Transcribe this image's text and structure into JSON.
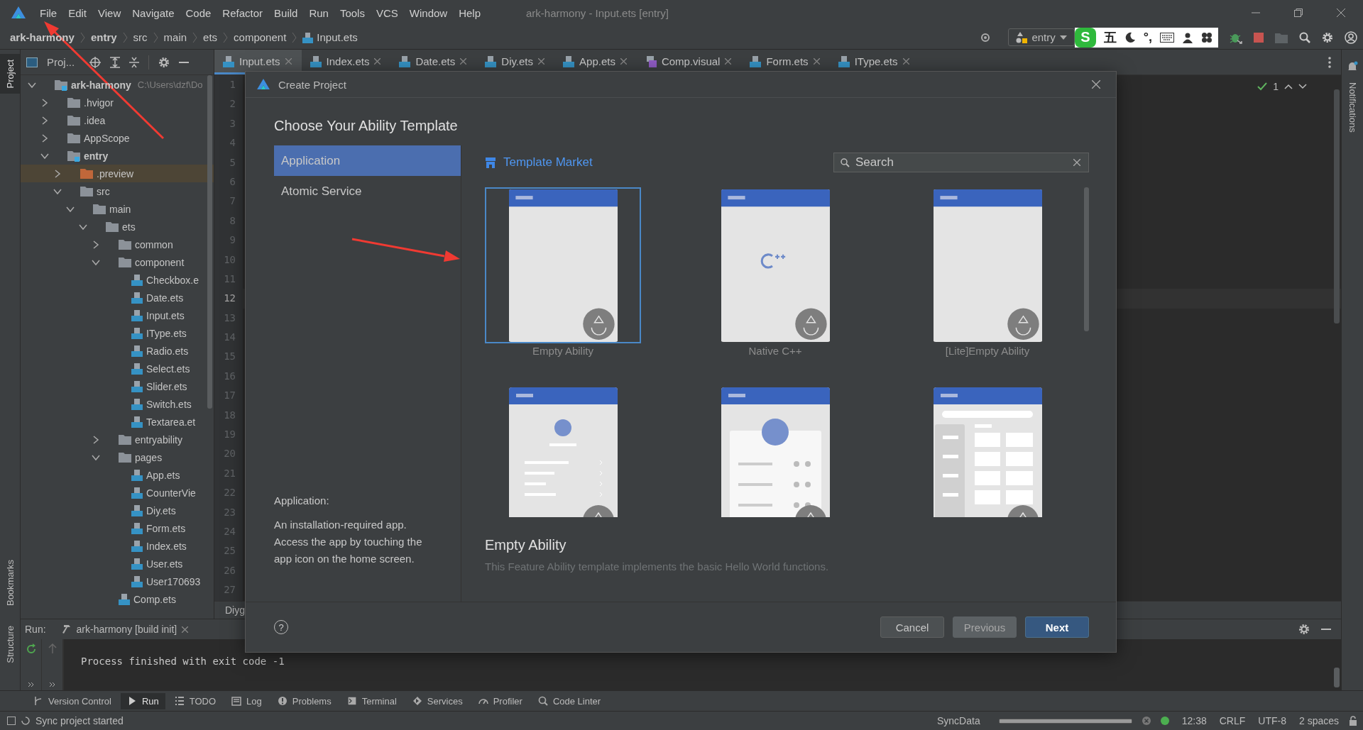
{
  "menu_bar": {
    "items": [
      "File",
      "Edit",
      "View",
      "Navigate",
      "Code",
      "Refactor",
      "Build",
      "Run",
      "Tools",
      "VCS",
      "Window",
      "Help"
    ],
    "window_title": "ark-harmony - Input.ets [entry]"
  },
  "nav_bar": {
    "crumbs": [
      {
        "label": "ark-harmony",
        "kind": "module"
      },
      {
        "label": "entry",
        "kind": "module"
      },
      {
        "label": "src",
        "kind": "folder"
      },
      {
        "label": "main",
        "kind": "folder"
      },
      {
        "label": "ets",
        "kind": "folder"
      },
      {
        "label": "component",
        "kind": "folder"
      },
      {
        "label": "Input.ets",
        "kind": "file"
      }
    ],
    "configuration": "entry",
    "ime": {
      "logo": "S",
      "mode": "五",
      "punctuation": "°,"
    }
  },
  "left_tool_windows": [
    {
      "label": "Project",
      "selected": true
    },
    {
      "label": "Bookmarks",
      "selected": false
    },
    {
      "label": "Structure",
      "selected": false
    }
  ],
  "right_tool_windows": [
    {
      "label": "Notifications",
      "selected": false
    }
  ],
  "project_panel": {
    "title": "Proj...",
    "tree": [
      {
        "label": "ark-harmony",
        "kind": "module",
        "path": "C:\\Users\\dzf\\Do",
        "expanded": true,
        "selected": false,
        "children": [
          {
            "label": ".hvigor",
            "kind": "folder",
            "expanded": false,
            "selected": false
          },
          {
            "label": ".idea",
            "kind": "folder",
            "expanded": false,
            "selected": false
          },
          {
            "label": "AppScope",
            "kind": "folder",
            "expanded": false,
            "selected": false
          },
          {
            "label": "entry",
            "kind": "module",
            "expanded": true,
            "selected": false,
            "children": [
              {
                "label": ".preview",
                "kind": "generated",
                "expanded": false,
                "selected": true
              },
              {
                "label": "src",
                "kind": "folder",
                "expanded": true,
                "selected": false,
                "children": [
                  {
                    "label": "main",
                    "kind": "folder",
                    "expanded": true,
                    "selected": false,
                    "children": [
                      {
                        "label": "ets",
                        "kind": "folder",
                        "expanded": true,
                        "selected": false,
                        "children": [
                          {
                            "label": "common",
                            "kind": "folder",
                            "expanded": false,
                            "selected": false
                          },
                          {
                            "label": "component",
                            "kind": "folder",
                            "expanded": true,
                            "selected": false,
                            "children": [
                              {
                                "label": "Checkbox.e",
                                "kind": "file",
                                "selected": false
                              },
                              {
                                "label": "Date.ets",
                                "kind": "file",
                                "selected": false
                              },
                              {
                                "label": "Input.ets",
                                "kind": "file",
                                "selected": false
                              },
                              {
                                "label": "IType.ets",
                                "kind": "file",
                                "selected": false
                              },
                              {
                                "label": "Radio.ets",
                                "kind": "file",
                                "selected": false
                              },
                              {
                                "label": "Select.ets",
                                "kind": "file",
                                "selected": false
                              },
                              {
                                "label": "Slider.ets",
                                "kind": "file",
                                "selected": false
                              },
                              {
                                "label": "Switch.ets",
                                "kind": "file",
                                "selected": false
                              },
                              {
                                "label": "Textarea.et",
                                "kind": "file",
                                "selected": false
                              }
                            ]
                          },
                          {
                            "label": "entryability",
                            "kind": "folder",
                            "expanded": false,
                            "selected": false
                          },
                          {
                            "label": "pages",
                            "kind": "folder",
                            "expanded": true,
                            "selected": false,
                            "children": [
                              {
                                "label": "App.ets",
                                "kind": "file",
                                "selected": false
                              },
                              {
                                "label": "CounterVie",
                                "kind": "file",
                                "selected": false
                              },
                              {
                                "label": "Diy.ets",
                                "kind": "file",
                                "selected": false
                              },
                              {
                                "label": "Form.ets",
                                "kind": "file",
                                "selected": false
                              },
                              {
                                "label": "Index.ets",
                                "kind": "file",
                                "selected": false
                              },
                              {
                                "label": "User.ets",
                                "kind": "file",
                                "selected": false
                              },
                              {
                                "label": "User170693",
                                "kind": "file",
                                "selected": false
                              }
                            ]
                          },
                          {
                            "label": "Comp.ets",
                            "kind": "file",
                            "selected": false
                          }
                        ]
                      }
                    ]
                  }
                ]
              }
            ]
          }
        ]
      }
    ]
  },
  "editor_tabs": [
    {
      "label": "Input.ets",
      "kind": "ets",
      "selected": true
    },
    {
      "label": "Index.ets",
      "kind": "ets",
      "selected": false
    },
    {
      "label": "Date.ets",
      "kind": "ets",
      "selected": false
    },
    {
      "label": "Diy.ets",
      "kind": "ets",
      "selected": false
    },
    {
      "label": "App.ets",
      "kind": "ets",
      "selected": false
    },
    {
      "label": "Comp.visual",
      "kind": "visual",
      "selected": false
    },
    {
      "label": "Form.ets",
      "kind": "ets",
      "selected": false
    },
    {
      "label": "IType.ets",
      "kind": "ets",
      "selected": false
    }
  ],
  "editor": {
    "inspection_count": "1",
    "bottom_text": "Diyg",
    "lines": [
      {
        "number": "1",
        "current": false
      },
      {
        "number": "2",
        "current": false
      },
      {
        "number": "3",
        "current": false
      },
      {
        "number": "4",
        "current": false
      },
      {
        "number": "5",
        "current": false
      },
      {
        "number": "6",
        "current": false
      },
      {
        "number": "7",
        "current": false
      },
      {
        "number": "8",
        "current": false
      },
      {
        "number": "9",
        "current": false
      },
      {
        "number": "10",
        "current": false
      },
      {
        "number": "11",
        "current": false
      },
      {
        "number": "12",
        "current": true
      },
      {
        "number": "13",
        "current": false
      },
      {
        "number": "14",
        "current": false
      },
      {
        "number": "15",
        "current": false
      },
      {
        "number": "16",
        "current": false
      },
      {
        "number": "17",
        "current": false
      },
      {
        "number": "18",
        "current": false
      },
      {
        "number": "19",
        "current": false
      },
      {
        "number": "20",
        "current": false
      },
      {
        "number": "21",
        "current": false
      },
      {
        "number": "22",
        "current": false
      },
      {
        "number": "23",
        "current": false
      },
      {
        "number": "24",
        "current": false
      },
      {
        "number": "25",
        "current": false
      },
      {
        "number": "26",
        "current": false
      },
      {
        "number": "27",
        "current": false
      }
    ]
  },
  "dialog": {
    "title": "Create Project",
    "heading": "Choose Your Ability Template",
    "categories": [
      {
        "label": "Application",
        "selected": true
      },
      {
        "label": "Atomic Service",
        "selected": false
      }
    ],
    "category_title": "Application:",
    "category_description": "An installation-required app. Access the app by touching the app icon on the home screen.",
    "market_link": "Template Market",
    "search": {
      "placeholder": "Search"
    },
    "templates": [
      {
        "label": "Empty Ability",
        "kind": "blank",
        "selected": true
      },
      {
        "label": "Native C++",
        "kind": "cpp",
        "selected": false
      },
      {
        "label": "[Lite]Empty Ability",
        "kind": "blank",
        "selected": false
      },
      {
        "kind": "list",
        "selected": false
      },
      {
        "kind": "profile",
        "selected": false
      },
      {
        "kind": "grid",
        "selected": false
      }
    ],
    "detail_title": "Empty Ability",
    "detail_description": "This Feature Ability template implements the basic Hello World functions.",
    "help": "?",
    "buttons": [
      {
        "label": "Cancel",
        "kind": "default"
      },
      {
        "label": "Previous",
        "kind": "secondary"
      },
      {
        "label": "Next",
        "kind": "primary"
      }
    ]
  },
  "run_panel": {
    "label": "Run:",
    "tab": "ark-harmony [build init]",
    "output": "Process finished with exit code -1"
  },
  "tool_windows": [
    {
      "label": "Version Control",
      "kind": "vcs",
      "selected": false
    },
    {
      "label": "Run",
      "kind": "run",
      "selected": true
    },
    {
      "label": "TODO",
      "kind": "todo",
      "selected": false
    },
    {
      "label": "Log",
      "kind": "log",
      "selected": false
    },
    {
      "label": "Problems",
      "kind": "problems",
      "selected": false
    },
    {
      "label": "Terminal",
      "kind": "terminal",
      "selected": false
    },
    {
      "label": "Services",
      "kind": "services",
      "selected": false
    },
    {
      "label": "Profiler",
      "kind": "profiler",
      "selected": false
    },
    {
      "label": "Code Linter",
      "kind": "linter",
      "selected": false
    }
  ],
  "status_bar": {
    "message": "Sync project started",
    "task": "SyncData",
    "progress": {
      "level": 1
    },
    "indicators": [
      "12:38",
      "CRLF",
      "UTF-8",
      "2 spaces"
    ]
  }
}
